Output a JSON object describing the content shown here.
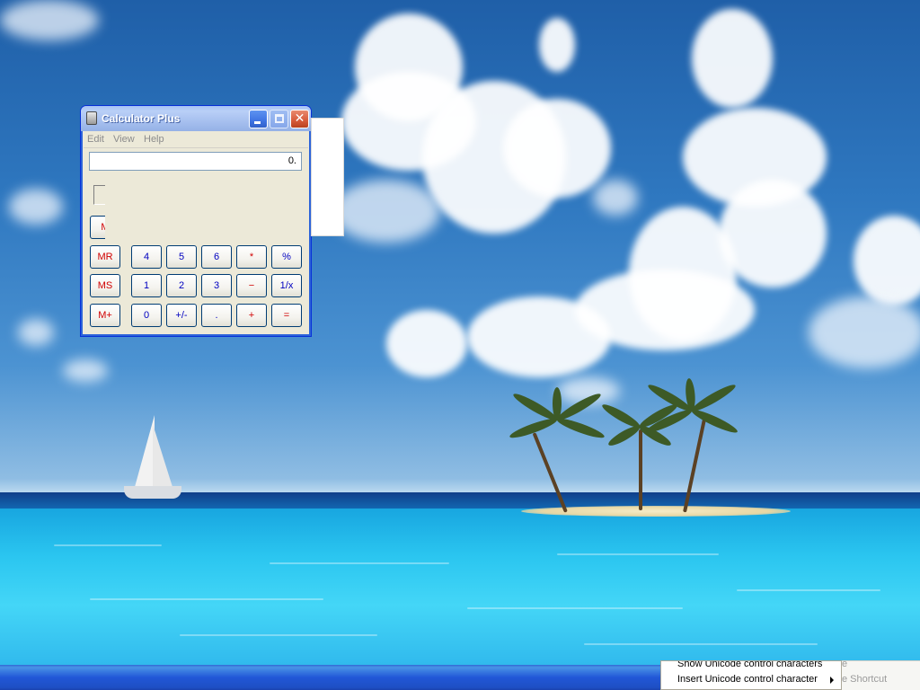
{
  "calculator": {
    "title": "Calculator Plus",
    "menu": {
      "edit": "Edit",
      "view": "View",
      "help": "Help"
    },
    "display_value": "0.",
    "buttons": {
      "m_partial": "M",
      "mr": "MR",
      "ms": "MS",
      "mplus": "M+",
      "n4": "4",
      "n5": "5",
      "n6": "6",
      "mul": "*",
      "pct": "%",
      "n1": "1",
      "n2": "2",
      "n3": "3",
      "sub": "−",
      "recip": "1/x",
      "n0": "0",
      "sign": "+/-",
      "dot": ".",
      "add": "+",
      "eq": "="
    }
  },
  "context_menu": {
    "item1": "Show Unicode control characters",
    "item2": "Insert Unicode control character"
  },
  "behind_menu": {
    "line1": "e",
    "line2": "e Shortcut"
  },
  "colors": {
    "taskbar": "#245edb",
    "digit_text": "#0000c0",
    "memory_text": "#d00000",
    "window_face": "#ece9d8"
  }
}
